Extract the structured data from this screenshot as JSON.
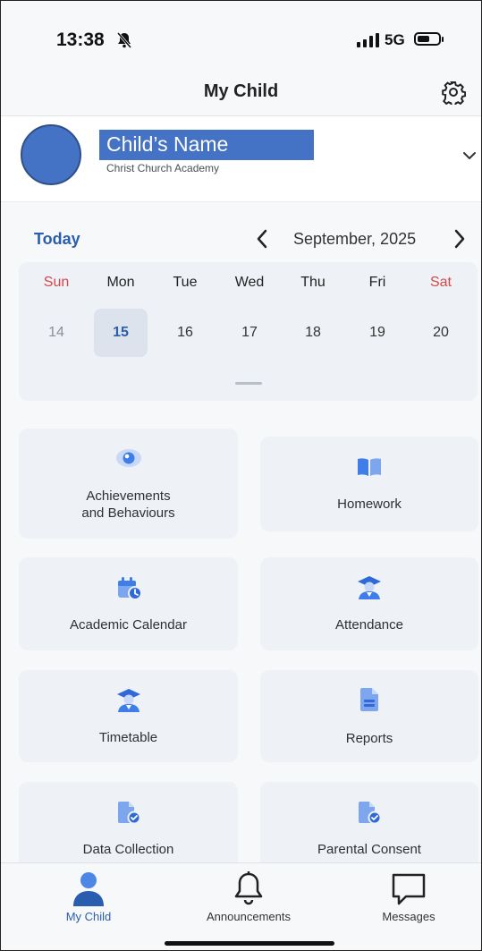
{
  "status_bar": {
    "time": "13:38",
    "network": "5G"
  },
  "header": {
    "title": "My Child"
  },
  "profile": {
    "child_name": "Child’s Name",
    "school": "Christ Church Academy"
  },
  "calendar": {
    "today_label": "Today",
    "month_label": "September, 2025",
    "days": [
      {
        "name": "Sun",
        "num": "14",
        "weekend": true
      },
      {
        "name": "Mon",
        "num": "15",
        "selected": true
      },
      {
        "name": "Tue",
        "num": "16"
      },
      {
        "name": "Wed",
        "num": "17"
      },
      {
        "name": "Thu",
        "num": "18"
      },
      {
        "name": "Fri",
        "num": "19"
      },
      {
        "name": "Sat",
        "num": "20",
        "weekend": true
      }
    ]
  },
  "tiles": [
    {
      "label1": "Achievements",
      "label2": "and Behaviours",
      "icon": "eye-icon"
    },
    {
      "label1": "Homework",
      "icon": "book-icon"
    },
    {
      "label1": "Academic Calendar",
      "icon": "calendar-clock-icon"
    },
    {
      "label1": "Attendance",
      "icon": "graduate-icon"
    },
    {
      "label1": "Timetable",
      "icon": "graduate-icon"
    },
    {
      "label1": "Reports",
      "icon": "document-icon"
    },
    {
      "label1": "Data Collection",
      "icon": "document-check-icon"
    },
    {
      "label1": "Parental Consent",
      "icon": "document-check-icon"
    }
  ],
  "tabbar": {
    "my_child": "My Child",
    "announcements": "Announcements",
    "messages": "Messages"
  },
  "colors": {
    "accent": "#2a5db0",
    "icon_blue": "#3f7de8",
    "weekend_red": "#d04a4a",
    "tile_bg": "#eef1f5",
    "placeholder_blue": "#4472c4"
  }
}
